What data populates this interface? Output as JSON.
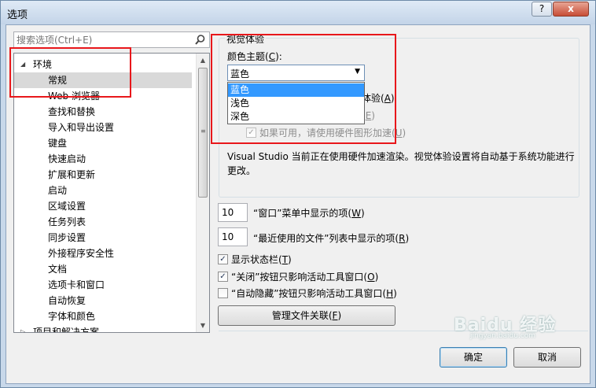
{
  "window": {
    "title": "选项",
    "help_label": "?",
    "close_label": "x"
  },
  "search": {
    "placeholder": "搜索选项(Ctrl+E)"
  },
  "tree": {
    "items": [
      {
        "label": "环境",
        "expanded": true
      },
      {
        "label": "常规",
        "selected": true
      },
      {
        "label": "Web 浏览器"
      },
      {
        "label": "查找和替换"
      },
      {
        "label": "导入和导出设置"
      },
      {
        "label": "键盘"
      },
      {
        "label": "快速启动"
      },
      {
        "label": "扩展和更新"
      },
      {
        "label": "启动"
      },
      {
        "label": "区域设置"
      },
      {
        "label": "任务列表"
      },
      {
        "label": "同步设置"
      },
      {
        "label": "外接程序安全性"
      },
      {
        "label": "文档"
      },
      {
        "label": "选项卡和窗口"
      },
      {
        "label": "自动恢复"
      },
      {
        "label": "字体和颜色"
      },
      {
        "label": "项目和解决方案",
        "expanded": false
      }
    ]
  },
  "visual": {
    "group_title": "视觉体验",
    "color_theme_label": "颜色主题(",
    "color_theme_key": "C",
    "color_theme_suffix": "):",
    "selected_theme": "蓝色",
    "theme_options": [
      "蓝色",
      "浅色",
      "深色"
    ],
    "partial_option_a": "体验(",
    "partial_option_a_key": "A",
    "partial_option_a_suffix": ")",
    "partial_option_e": "(",
    "partial_option_e_key": "E",
    "partial_option_e_suffix": ")",
    "hw_accel_label": "如果可用，请使用硬件图形加速(",
    "hw_accel_key": "U",
    "hw_accel_suffix": ")",
    "hw_accel_checked": true,
    "description": "Visual Studio 当前正在使用硬件加速渲染。视觉体验设置将自动基于系统功能进行更改。"
  },
  "window_menu": {
    "value": "10",
    "label": "“窗口”菜单中显示的项(",
    "key": "W",
    "suffix": ")"
  },
  "recent_files": {
    "value": "10",
    "label": "“最近使用的文件”列表中显示的项(",
    "key": "R",
    "suffix": ")"
  },
  "checkboxes": [
    {
      "label": "显示状态栏(",
      "key": "T",
      "suffix": ")",
      "checked": true
    },
    {
      "label": "“关闭”按钮只影响活动工具窗口(",
      "key": "O",
      "suffix": ")",
      "checked": true
    },
    {
      "label": "“自动隐藏”按钮只影响活动工具窗口(",
      "key": "H",
      "suffix": ")",
      "checked": false
    }
  ],
  "buttons": {
    "file_assoc": "管理文件关联(",
    "file_assoc_key": "F",
    "file_assoc_suffix": ")",
    "ok": "确定",
    "cancel": "取消"
  },
  "watermark": {
    "text": "Baidu 经验",
    "sub": "jingyan.baidu.com"
  },
  "colors": {
    "annotation": "#e8171b",
    "highlight": "#3399ff",
    "selected_row": "#d9d9d9"
  }
}
